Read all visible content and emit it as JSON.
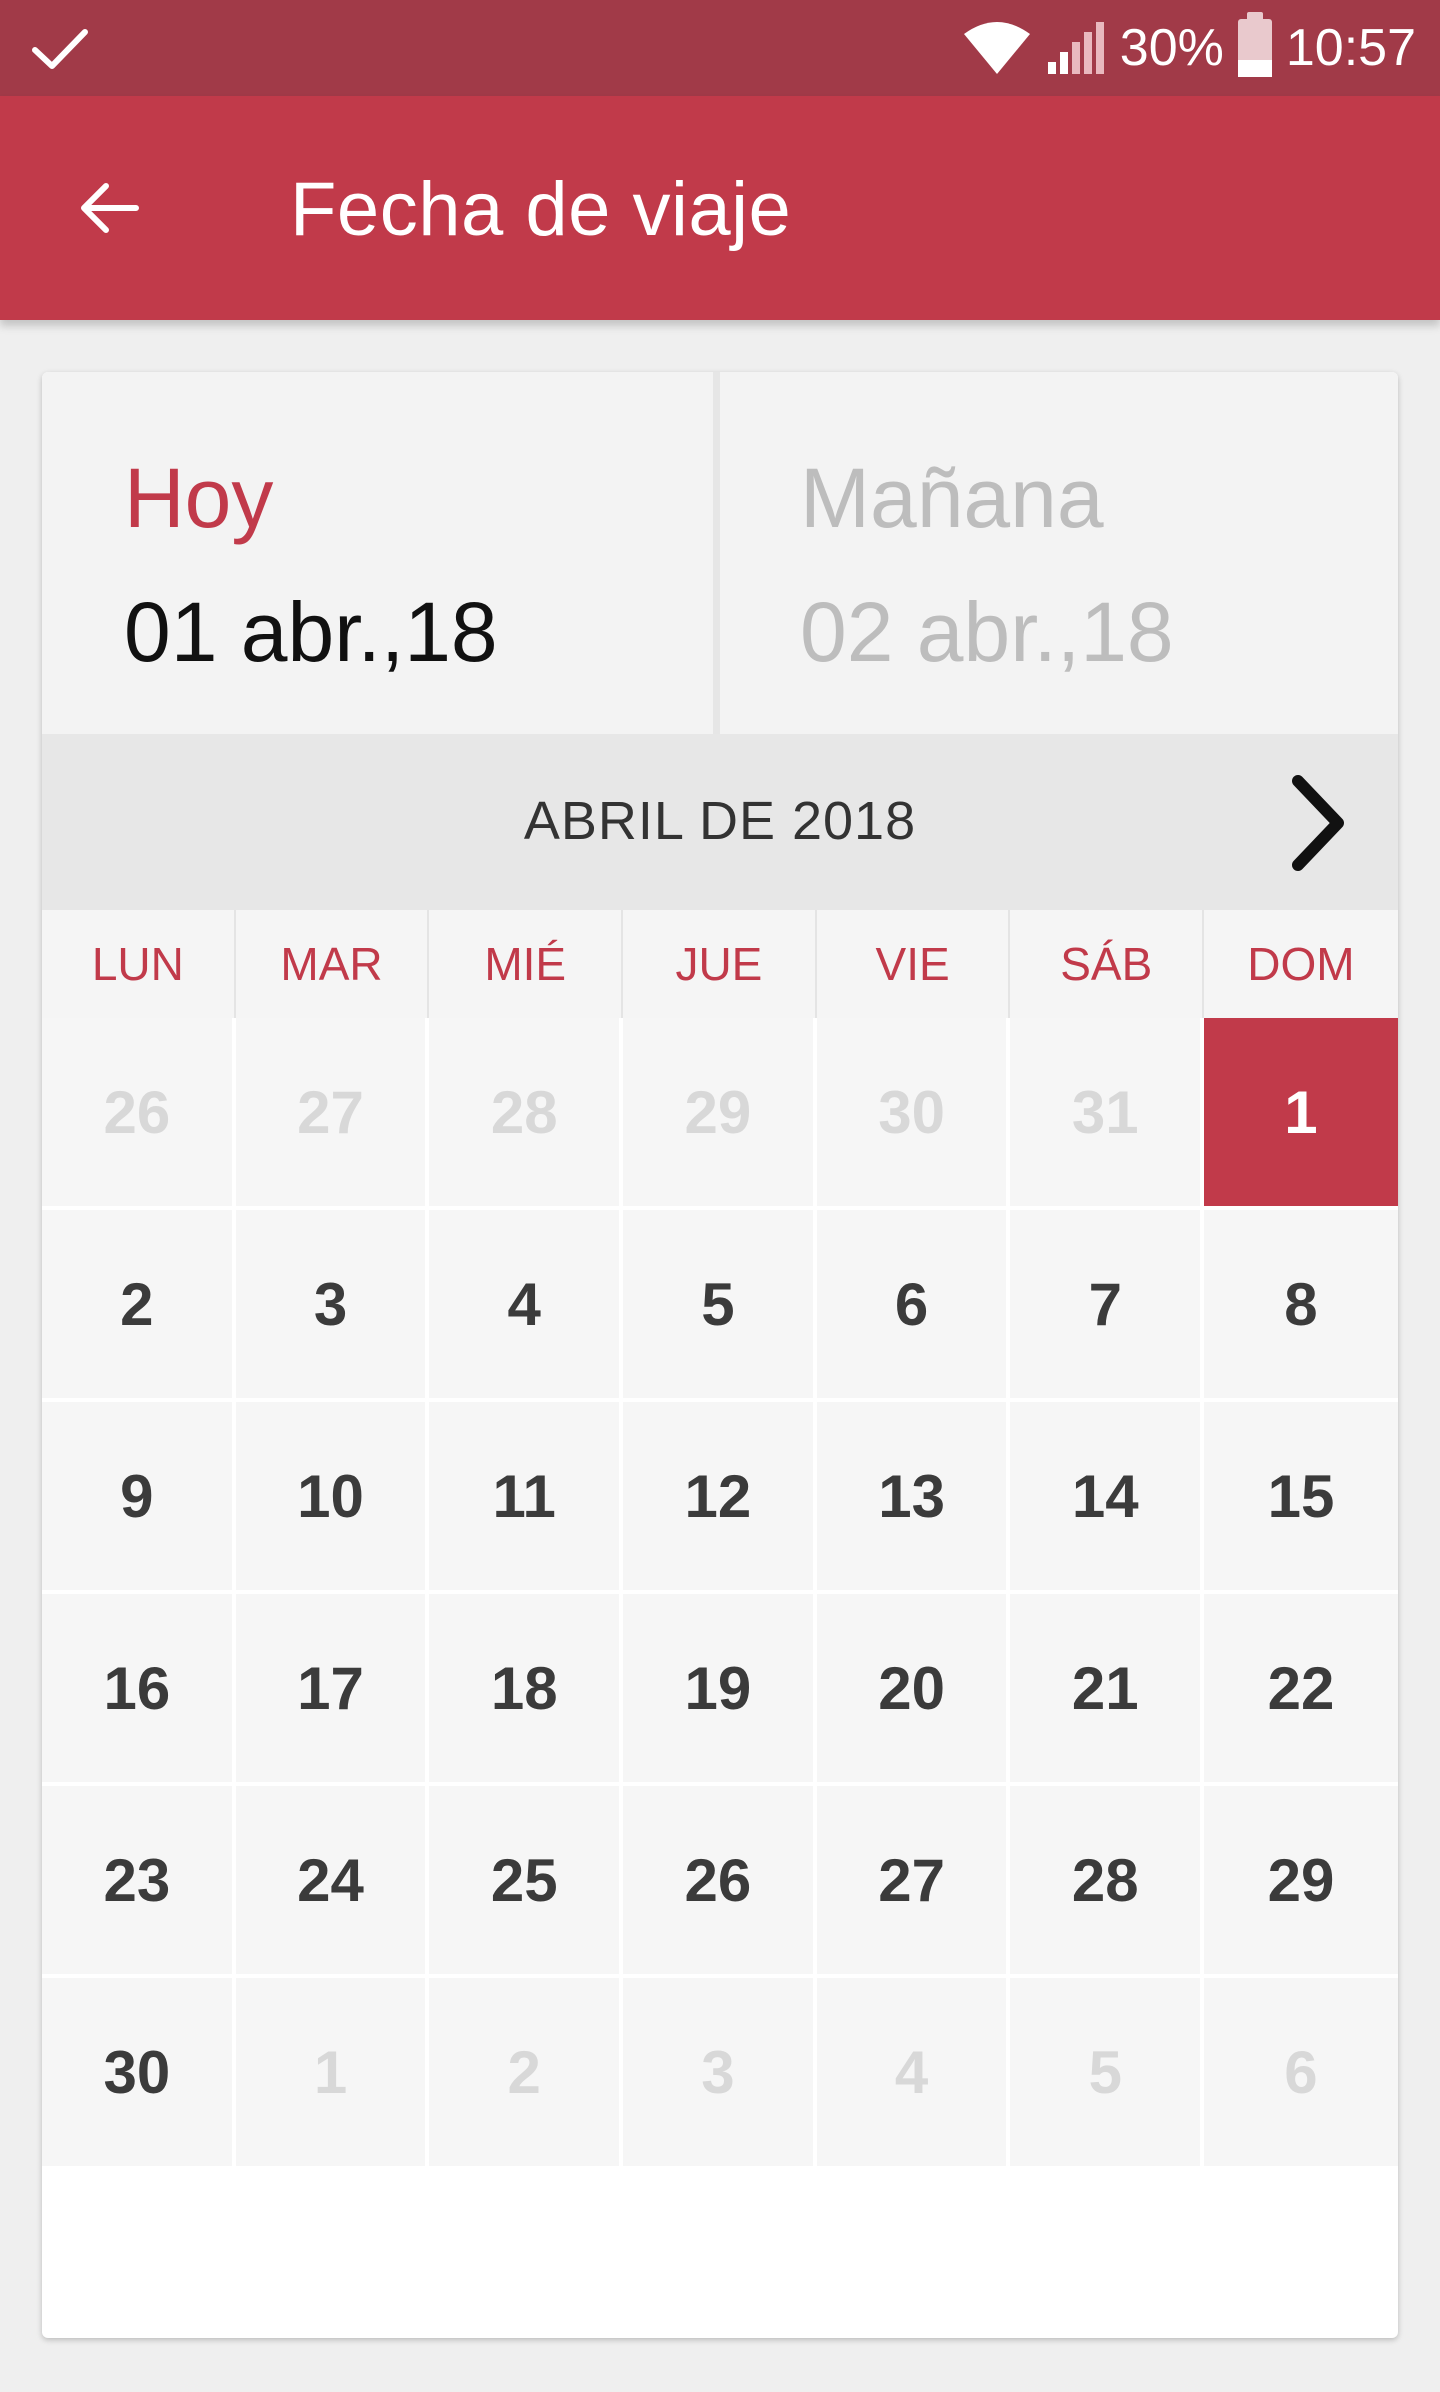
{
  "status_bar": {
    "battery_percent": "30%",
    "time": "10:57"
  },
  "app_bar": {
    "title": "Fecha de viaje"
  },
  "date_tabs": [
    {
      "label": "Hoy",
      "date": "01 abr.,18"
    },
    {
      "label": "Mañana",
      "date": "02 abr.,18"
    }
  ],
  "calendar": {
    "month_title": "ABRIL DE 2018",
    "weekdays": [
      "LUN",
      "MAR",
      "MIÉ",
      "JUE",
      "VIE",
      "SÁB",
      "DOM"
    ],
    "weeks": [
      [
        "26",
        "27",
        "28",
        "29",
        "30",
        "31",
        "1"
      ],
      [
        "2",
        "3",
        "4",
        "5",
        "6",
        "7",
        "8"
      ],
      [
        "9",
        "10",
        "11",
        "12",
        "13",
        "14",
        "15"
      ],
      [
        "16",
        "17",
        "18",
        "19",
        "20",
        "21",
        "22"
      ],
      [
        "23",
        "24",
        "25",
        "26",
        "27",
        "28",
        "29"
      ],
      [
        "30",
        "1",
        "2",
        "3",
        "4",
        "5",
        "6"
      ]
    ],
    "selected_day": "1"
  },
  "colors": {
    "status_bar": "#a13a48",
    "app_bar": "#c13a4a",
    "accent": "#c13a4a"
  },
  "icons": {
    "status_check": "check-icon",
    "wifi": "wifi-icon",
    "signal": "signal-icon",
    "battery": "battery-icon",
    "back": "arrow-left-icon",
    "next_month": "chevron-right-icon"
  }
}
